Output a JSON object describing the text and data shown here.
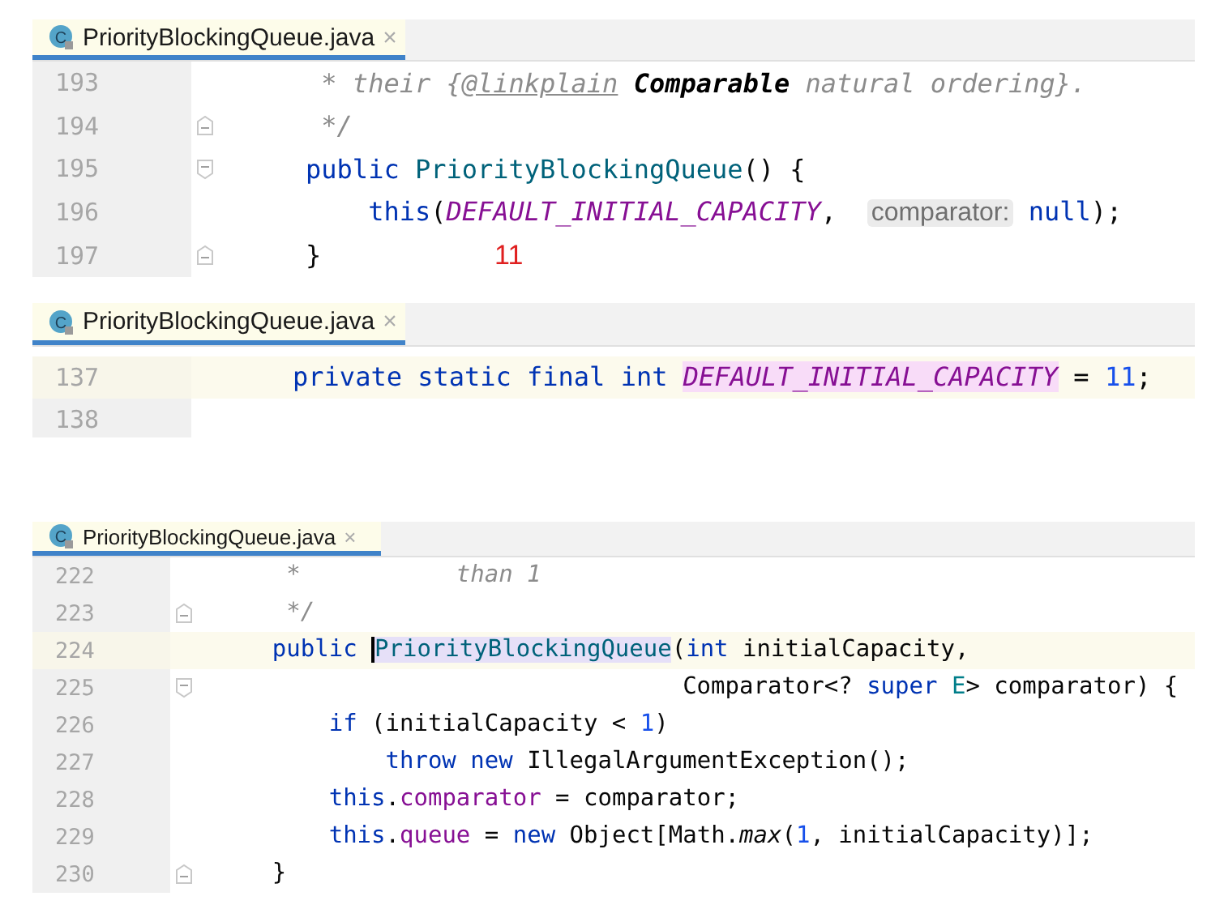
{
  "panels": [
    {
      "tab": {
        "icon_letter": "C",
        "title": "PriorityBlockingQueue.java",
        "close": "×"
      },
      "annotation": "11",
      "lines": [
        {
          "number": "193",
          "tokens": [
            {
              "text": "     * their {",
              "kind": "comment"
            },
            {
              "text": "@linkplain",
              "kind": "doctag"
            },
            {
              "text": " Comparable",
              "kind": "docbold"
            },
            {
              "text": " natural ordering}.",
              "kind": "comment"
            }
          ]
        },
        {
          "number": "194",
          "fold_end": true,
          "tokens": [
            {
              "text": "     */",
              "kind": "comment"
            }
          ]
        },
        {
          "number": "195",
          "fold_start": true,
          "tokens": [
            {
              "text": "    public ",
              "kind": "kw"
            },
            {
              "text": "PriorityBlockingQueue",
              "kind": "decl"
            },
            {
              "text": "() {",
              "kind": "plain"
            }
          ]
        },
        {
          "number": "196",
          "tokens": [
            {
              "text": "        this",
              "kind": "kw"
            },
            {
              "text": "(",
              "kind": "plain"
            },
            {
              "text": "DEFAULT_INITIAL_CAPACITY",
              "kind": "const"
            },
            {
              "text": ",  ",
              "kind": "plain"
            },
            {
              "text": "comparator:",
              "kind": "hint"
            },
            {
              "text": " null",
              "kind": "kw"
            },
            {
              "text": ");",
              "kind": "plain"
            }
          ]
        },
        {
          "number": "197",
          "fold_end": true,
          "tokens": [
            {
              "text": "    }",
              "kind": "plain"
            }
          ]
        }
      ]
    },
    {
      "tab": {
        "icon_letter": "C",
        "title": "PriorityBlockingQueue.java",
        "close": "×"
      },
      "lines": [
        {
          "number": "137",
          "current": true,
          "tokens": [
            {
              "text": "    private static final int ",
              "kind": "kw"
            },
            {
              "text": "DEFAULT_INITIAL_CAPACITY",
              "kind": "const",
              "highlight": true
            },
            {
              "text": " = ",
              "kind": "plain"
            },
            {
              "text": "11",
              "kind": "num"
            },
            {
              "text": ";",
              "kind": "plain"
            }
          ]
        },
        {
          "number": "138"
        }
      ]
    },
    {
      "tab": {
        "icon_letter": "C",
        "title": "PriorityBlockingQueue.java",
        "close": "×"
      },
      "lines": [
        {
          "number": "222",
          "tokens": [
            {
              "text": "     *           than 1",
              "kind": "comment"
            }
          ]
        },
        {
          "number": "223",
          "fold_end": true,
          "tokens": [
            {
              "text": "     */",
              "kind": "comment"
            }
          ]
        },
        {
          "number": "224",
          "current": true,
          "tokens": [
            {
              "text": "    public ",
              "kind": "kw"
            },
            {
              "text": "PriorityBlockingQueue",
              "kind": "decl",
              "highlight": true,
              "caret": true
            },
            {
              "text": "(",
              "kind": "plain"
            },
            {
              "text": "int ",
              "kind": "kw"
            },
            {
              "text": "initialCapacity,",
              "kind": "plain"
            }
          ]
        },
        {
          "number": "225",
          "fold_start": true,
          "tokens": [
            {
              "text": "                                 Comparator<? ",
              "kind": "plain"
            },
            {
              "text": "super ",
              "kind": "kw"
            },
            {
              "text": "E",
              "kind": "typeparam"
            },
            {
              "text": "> comparator) {",
              "kind": "plain"
            }
          ]
        },
        {
          "number": "226",
          "tokens": [
            {
              "text": "        if ",
              "kind": "kw"
            },
            {
              "text": "(initialCapacity < ",
              "kind": "plain"
            },
            {
              "text": "1",
              "kind": "num"
            },
            {
              "text": ")",
              "kind": "plain"
            }
          ]
        },
        {
          "number": "227",
          "tokens": [
            {
              "text": "            throw new ",
              "kind": "kw"
            },
            {
              "text": "IllegalArgumentException();",
              "kind": "plain"
            }
          ]
        },
        {
          "number": "228",
          "tokens": [
            {
              "text": "        this",
              "kind": "kw"
            },
            {
              "text": ".",
              "kind": "plain"
            },
            {
              "text": "comparator",
              "kind": "field"
            },
            {
              "text": " = comparator;",
              "kind": "plain"
            }
          ]
        },
        {
          "number": "229",
          "tokens": [
            {
              "text": "        this",
              "kind": "kw"
            },
            {
              "text": ".",
              "kind": "plain"
            },
            {
              "text": "queue",
              "kind": "field"
            },
            {
              "text": " = ",
              "kind": "plain"
            },
            {
              "text": "new ",
              "kind": "kw"
            },
            {
              "text": "Object[Math.",
              "kind": "plain"
            },
            {
              "text": "max",
              "kind": "static"
            },
            {
              "text": "(",
              "kind": "plain"
            },
            {
              "text": "1",
              "kind": "num"
            },
            {
              "text": ", initialCapacity)];",
              "kind": "plain"
            }
          ]
        },
        {
          "number": "230",
          "fold_end": true,
          "tokens": [
            {
              "text": "    }",
              "kind": "plain"
            }
          ]
        }
      ]
    }
  ]
}
